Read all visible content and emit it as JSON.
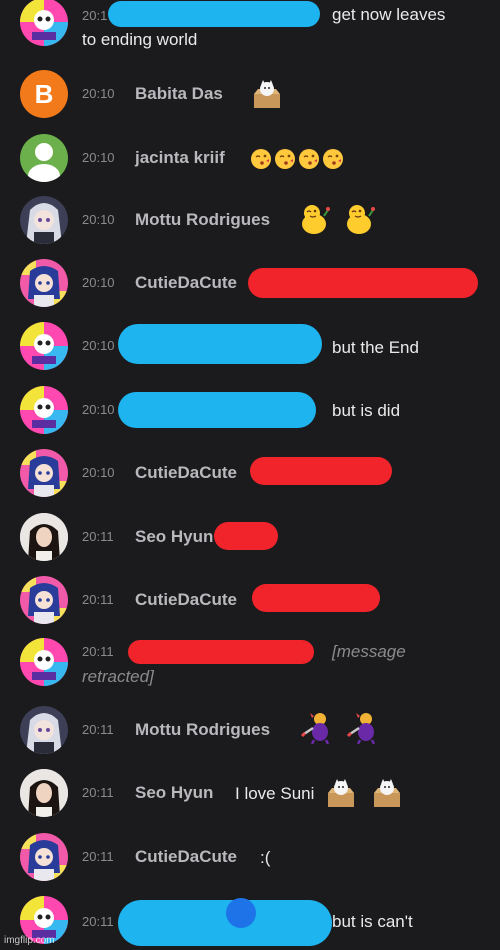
{
  "messages": [
    {
      "time": "20:1",
      "text": "get now leaves",
      "continuation": "to ending world",
      "avatar": "pink-yellow-checkered-avatar"
    },
    {
      "time": "20:10",
      "name": "Babita Das",
      "avatar_letter": "B",
      "avatar": "orange-letter-avatar",
      "sticker": "box-cat-sticker"
    },
    {
      "time": "20:10",
      "name": "jacinta kriif",
      "avatar": "default-person-avatar",
      "emoji": "kiss-face-emoji"
    },
    {
      "time": "20:10",
      "name": "Mottu Rodrigues",
      "avatar": "anime-avatar",
      "sticker": "waving-duck-sticker"
    },
    {
      "time": "20:10",
      "name": "CutieDaCute",
      "avatar": "anime-girl-avatar"
    },
    {
      "time": "20:10",
      "text": "but the End",
      "avatar": "pink-yellow-checkered-avatar"
    },
    {
      "time": "20:10",
      "text": "but is did",
      "avatar": "pink-yellow-checkered-avatar"
    },
    {
      "time": "20:10",
      "name": "CutieDaCute",
      "avatar": "anime-girl-avatar"
    },
    {
      "time": "20:11",
      "name": "Seo Hyun",
      "avatar": "photo-avatar"
    },
    {
      "time": "20:11",
      "name": "CutieDaCute",
      "avatar": "anime-girl-avatar"
    },
    {
      "time": "20:11",
      "text": "[message",
      "continuation": "retracted]",
      "avatar": "pink-yellow-checkered-avatar"
    },
    {
      "time": "20:11",
      "name": "Mottu Rodrigues",
      "avatar": "anime-avatar",
      "sticker": "purple-creature-sticker"
    },
    {
      "time": "20:11",
      "name": "Seo Hyun",
      "text": "I love Suni",
      "avatar": "photo-avatar",
      "sticker": "box-cat-sticker"
    },
    {
      "time": "20:11",
      "name": "CutieDaCute",
      "text": ":(",
      "avatar": "anime-girl-avatar"
    },
    {
      "time": "20:11",
      "text": "but is can't",
      "avatar": "pink-yellow-checkered-avatar"
    }
  ],
  "watermark": "imgflip.com",
  "colors": {
    "background": "#1b1b1d",
    "scribble_blue": "#1db4ef",
    "scribble_red": "#f0242a",
    "babita_avatar": "#f27a1a",
    "default_avatar": "#6bb04a"
  }
}
